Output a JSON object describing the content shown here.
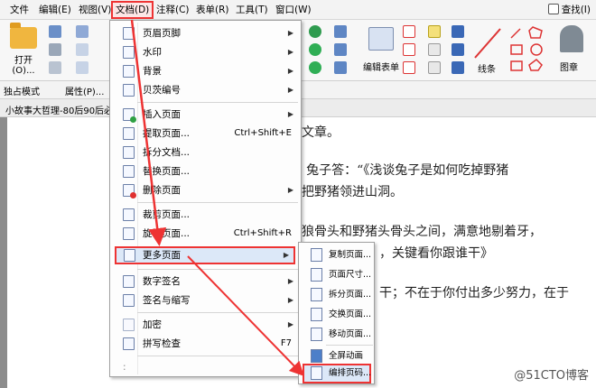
{
  "menubar": {
    "items": [
      "文件",
      "编辑(E)",
      "视图(V)",
      "文档(D)",
      "注释(C)",
      "表单(R)",
      "工具(T)",
      "窗口(W)"
    ],
    "active_index": 3,
    "search_label": "查找(I)"
  },
  "ribbon": {
    "open_label": "打开(O)...",
    "edit_form_label": "编辑表单",
    "line_label": "线条",
    "stamp_label": "图章"
  },
  "toolbar2": {
    "exclusive_mode": "独占模式",
    "properties": "属性(P)..."
  },
  "doc_tab": {
    "title": "小故事大哲理-80后90后必读"
  },
  "document": {
    "lines": [
      "写文章。",
      "?”  兔子答：“《浅谈兔子是如何吃掉野猪",
      "又把野猪领进山洞。",
      "堆狼骨头和野猪头骨头之间，满意地剔着牙，",
      "，关键看你跟谁干》",
      "干；不在于你付出多少努力，在于"
    ],
    "watermark": "@51CTO博客"
  },
  "doc_menu": {
    "items": [
      {
        "label": "页眉页脚",
        "submenu": true
      },
      {
        "label": "水印",
        "submenu": true
      },
      {
        "label": "背景",
        "submenu": true
      },
      {
        "label": "贝茨编号",
        "submenu": true
      },
      {
        "label": "插入页面",
        "submenu": true
      },
      {
        "label": "提取页面...",
        "shortcut": "Ctrl+Shift+E"
      },
      {
        "label": "拆分文档..."
      },
      {
        "label": "替换页面..."
      },
      {
        "label": "删除页面",
        "submenu": true
      },
      {
        "label": "裁剪页面..."
      },
      {
        "label": "旋转页面...",
        "shortcut": "Ctrl+Shift+R"
      },
      {
        "label": "更多页面",
        "submenu": true,
        "highlighted": true
      },
      {
        "label": "数字签名",
        "submenu": true
      },
      {
        "label": "签名与缩写",
        "submenu": true
      },
      {
        "label": "加密",
        "submenu": true
      },
      {
        "label": "拼写检查",
        "shortcut": "F7"
      },
      {
        "label": ":"
      }
    ]
  },
  "more_pages_submenu": {
    "items": [
      {
        "label": "复制页面..."
      },
      {
        "label": "页面尺寸..."
      },
      {
        "label": "拆分页面..."
      },
      {
        "label": "交换页面..."
      },
      {
        "label": "移动页面..."
      },
      {
        "label": "全屏动画"
      },
      {
        "label": "编排页码...",
        "highlighted": true
      }
    ]
  },
  "colors": {
    "highlight_border": "#e33333",
    "arrow": "#e33333",
    "menu_highlight": "#dce8f8"
  }
}
